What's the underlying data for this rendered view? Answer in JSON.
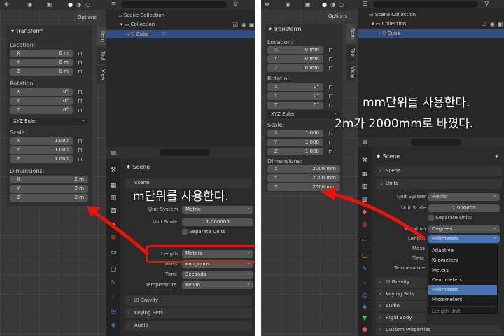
{
  "left": {
    "options": "Options",
    "transform_title": "Transform",
    "location_label": "Location:",
    "loc": [
      {
        "k": "X",
        "v": "0 m"
      },
      {
        "k": "Y",
        "v": "0 m"
      },
      {
        "k": "Z",
        "v": "0 m"
      }
    ],
    "rotation_label": "Rotation:",
    "rot": [
      {
        "k": "X",
        "v": "0°"
      },
      {
        "k": "Y",
        "v": "0°"
      },
      {
        "k": "Z",
        "v": "0°"
      }
    ],
    "rot_mode": "XYZ Euler",
    "scale_label": "Scale:",
    "scl": [
      {
        "k": "X",
        "v": "1.000"
      },
      {
        "k": "Y",
        "v": "1.000"
      },
      {
        "k": "Z",
        "v": "1.000"
      }
    ],
    "dim_label": "Dimensions:",
    "dim": [
      {
        "k": "X",
        "v": "2 m"
      },
      {
        "k": "Y",
        "v": "2 m"
      },
      {
        "k": "Z",
        "v": "2 m"
      }
    ],
    "tabs": [
      "Item",
      "Tool",
      "View"
    ],
    "outliner": {
      "scene_collection": "Scene Collection",
      "collection": "Collection",
      "cube": "Cube"
    },
    "props": {
      "scene": "Scene",
      "scene_sec": "Scene",
      "unit_system_label": "Unit System",
      "unit_system": "Metric",
      "unit_scale_label": "Unit Scale",
      "unit_scale": "1.000000",
      "separate_units": "Separate Units",
      "length_label": "Length",
      "length": "Meters",
      "mass_label": "Mass",
      "mass": "Kilograms",
      "time_label": "Time",
      "time": "Seconds",
      "temp_label": "Temperature",
      "temp": "Kelvin",
      "gravity": "Gravity",
      "keying": "Keying Sets",
      "audio": "Audio"
    },
    "annotation": "m단위를 사용한다."
  },
  "right": {
    "options": "Options",
    "transform_title": "Transform",
    "location_label": "Location:",
    "loc": [
      {
        "k": "X",
        "v": "0 mm"
      },
      {
        "k": "Y",
        "v": "0 mm"
      },
      {
        "k": "Z",
        "v": "0 mm"
      }
    ],
    "rotation_label": "Rotation:",
    "rot": [
      {
        "k": "X",
        "v": "0°"
      },
      {
        "k": "Y",
        "v": "0°"
      },
      {
        "k": "Z",
        "v": "0°"
      }
    ],
    "rot_mode": "XYZ Euler",
    "scale_label": "Scale:",
    "scl": [
      {
        "k": "X",
        "v": "1.000"
      },
      {
        "k": "Y",
        "v": "1.000"
      },
      {
        "k": "Z",
        "v": "1.000"
      }
    ],
    "dim_label": "Dimensions:",
    "dim": [
      {
        "k": "X",
        "v": "2000 mm"
      },
      {
        "k": "Y",
        "v": "2000 mm"
      },
      {
        "k": "Z",
        "v": "2000 mm"
      }
    ],
    "tabs": [
      "Item",
      "Tool",
      "View"
    ],
    "outliner": {
      "scene_collection": "Scene Collection",
      "collection": "Collection",
      "cube": "Cube"
    },
    "props": {
      "scene": "Scene",
      "scene_sec": "Scene",
      "units_sec": "Units",
      "unit_system_label": "Unit System",
      "unit_system": "Metric",
      "unit_scale_label": "Unit Scale",
      "unit_scale": "1.000000",
      "separate_units": "Separate Units",
      "rotation_label": "Rotation",
      "rotation": "Degrees",
      "length_label": "Length",
      "length": "Millimeters",
      "mass_label": "Mass",
      "time_label": "Time",
      "temp_label": "Temperature",
      "gravity": "Gravity",
      "keying": "Keying Sets",
      "audio": "Audio",
      "rigid": "Rigid Body World",
      "custom": "Custom Properties"
    },
    "length_menu": [
      "Adaptive",
      "Kilometers",
      "Meters",
      "Centimeters",
      "Millimeters",
      "Micrometers"
    ],
    "menu_footer": "Length Unit",
    "annotation1": "mm단위를 사용한다.",
    "annotation2": "2m가 2000mm로 바꼈다."
  },
  "colors": {
    "accent": "#4772b3",
    "arrow": "#e8140a",
    "selected": "#334d80"
  }
}
